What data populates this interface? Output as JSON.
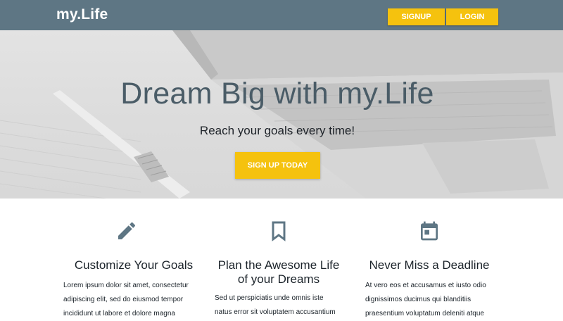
{
  "header": {
    "brand": "my.Life",
    "signup_label": "SIGNUP",
    "login_label": "LOGIN"
  },
  "hero": {
    "title": "Dream Big with my.Life",
    "subtitle": "Reach your goals every time!",
    "cta_label": "SIGN UP TODAY"
  },
  "features": [
    {
      "icon": "pencil-icon",
      "title": "Customize Your Goals",
      "text_lines": [
        "Lorem ipsum dolor sit amet, consectetur",
        "adipiscing elit, sed do eiusmod tempor",
        "incididunt ut labore et dolore magna"
      ]
    },
    {
      "icon": "bookmark-icon",
      "title_line1": "Plan the Awesome Life",
      "title_line2": "of your Dreams",
      "text_lines": [
        "Sed ut perspiciatis unde omnis iste",
        "natus error sit voluptatem accusantium"
      ]
    },
    {
      "icon": "calendar-icon",
      "title": "Never Miss a Deadline",
      "text_lines": [
        "At vero eos et accusamus et iusto odio",
        "dignissimos ducimus qui blanditiis",
        "praesentium voluptatum deleniti atque"
      ]
    }
  ],
  "colors": {
    "header_bg": "#5e7684",
    "accent": "#f5c20e",
    "icon": "#5e7684",
    "hero_title": "#4a5c67"
  }
}
